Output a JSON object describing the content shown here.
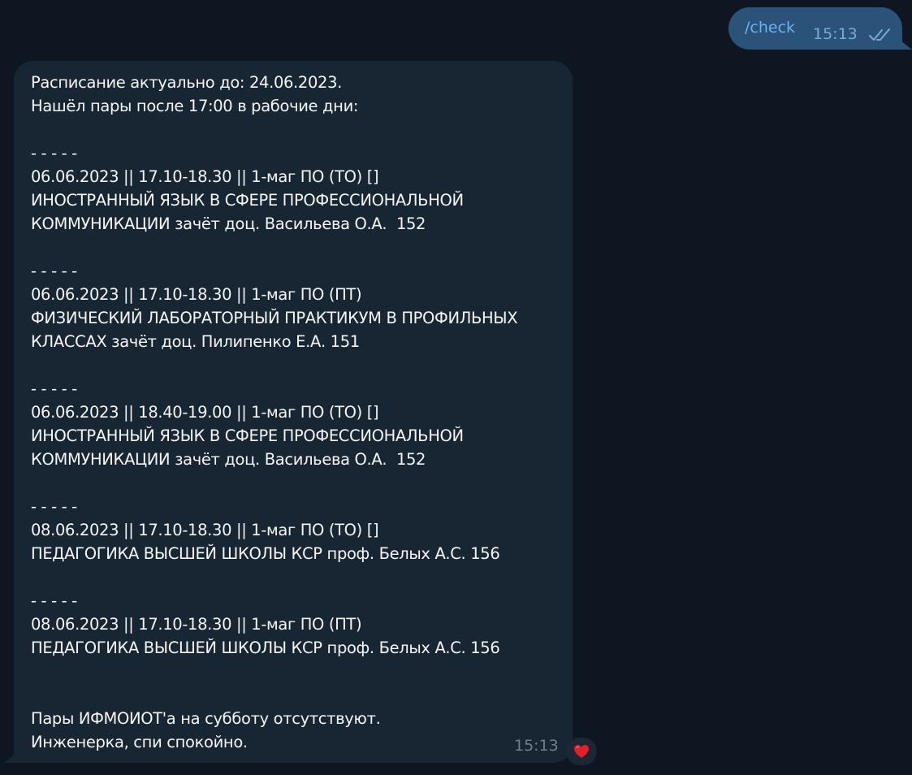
{
  "outgoing": {
    "text": "/check",
    "time": "15:13",
    "status_icon": "double-check-icon",
    "link_color": "#6ab2f2"
  },
  "incoming": {
    "text": "Расписание актуально до: 24.06.2023.\nНашёл пары после 17:00 в рабочие дни:\n\n- - - - -\n06.06.2023 || 17.10-18.30 || 1-маг ПО (ТО) []\nИНОСТРАННЫЙ ЯЗЫК В СФЕРЕ ПРОФЕССИОНАЛЬНОЙ\nКОММУНИКАЦИИ зачёт доц. Васильева О.А.  152\n\n- - - - -\n06.06.2023 || 17.10-18.30 || 1-маг ПО (ПТ)\nФИЗИЧЕСКИЙ ЛАБОРАТОРНЫЙ ПРАКТИКУМ В ПРОФИЛЬНЫХ\nКЛАССАХ зачёт доц. Пилипенко Е.А. 151\n\n- - - - -\n06.06.2023 || 18.40-19.00 || 1-маг ПО (ТО) []\nИНОСТРАННЫЙ ЯЗЫК В СФЕРЕ ПРОФЕССИОНАЛЬНОЙ\nКОММУНИКАЦИИ зачёт доц. Васильева О.А.  152\n\n- - - - -\n08.06.2023 || 17.10-18.30 || 1-маг ПО (ТО) []\nПЕДАГОГИКА ВЫСШЕЙ ШКОЛЫ КСР проф. Белых А.С. 156\n\n- - - - -\n08.06.2023 || 17.10-18.30 || 1-маг ПО (ПТ)\nПЕДАГОГИКА ВЫСШЕЙ ШКОЛЫ КСР проф. Белых А.С. 156\n\n\nПары ИФМОИОТ'а на субботу отсутствуют.\nИнженерка, спи спокойно.",
    "time": "15:13",
    "reaction_icon": "heart-icon",
    "reaction_color": "#e0202a"
  }
}
